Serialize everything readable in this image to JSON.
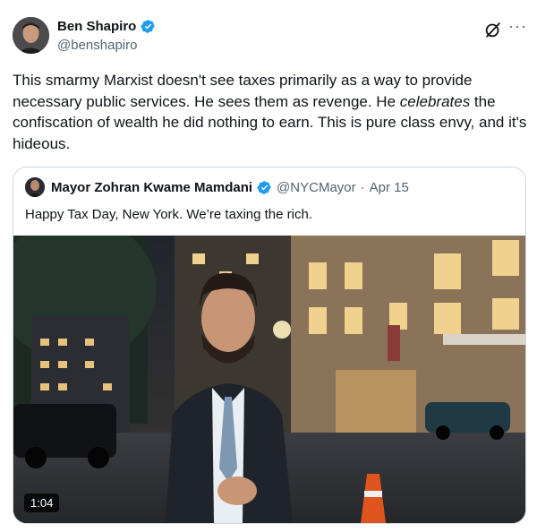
{
  "author": {
    "name": "Ben Shapiro",
    "handle": "@benshapiro"
  },
  "tweet": {
    "text_before": "This smarmy Marxist doesn't see taxes primarily as a way to provide necessary public services. He sees them as revenge. He ",
    "text_italic": "celebrates",
    "text_after": " the confiscation of wealth he did nothing to earn. This is pure class envy, and it's hideous."
  },
  "quoted": {
    "name": "Mayor Zohran Kwame Mamdani",
    "handle": "@NYCMayor",
    "separator": "·",
    "date": "Apr 15",
    "text": "Happy Tax Day, New York. We’re taxing the rich.",
    "video_duration": "1:04"
  },
  "icons": {
    "verified": "verified-badge-icon",
    "grok": "grok-icon",
    "more": "more-options-icon"
  },
  "colors": {
    "verified_blue": "#1d9bf0",
    "secondary_text": "#536471",
    "border": "#cfd9de"
  }
}
